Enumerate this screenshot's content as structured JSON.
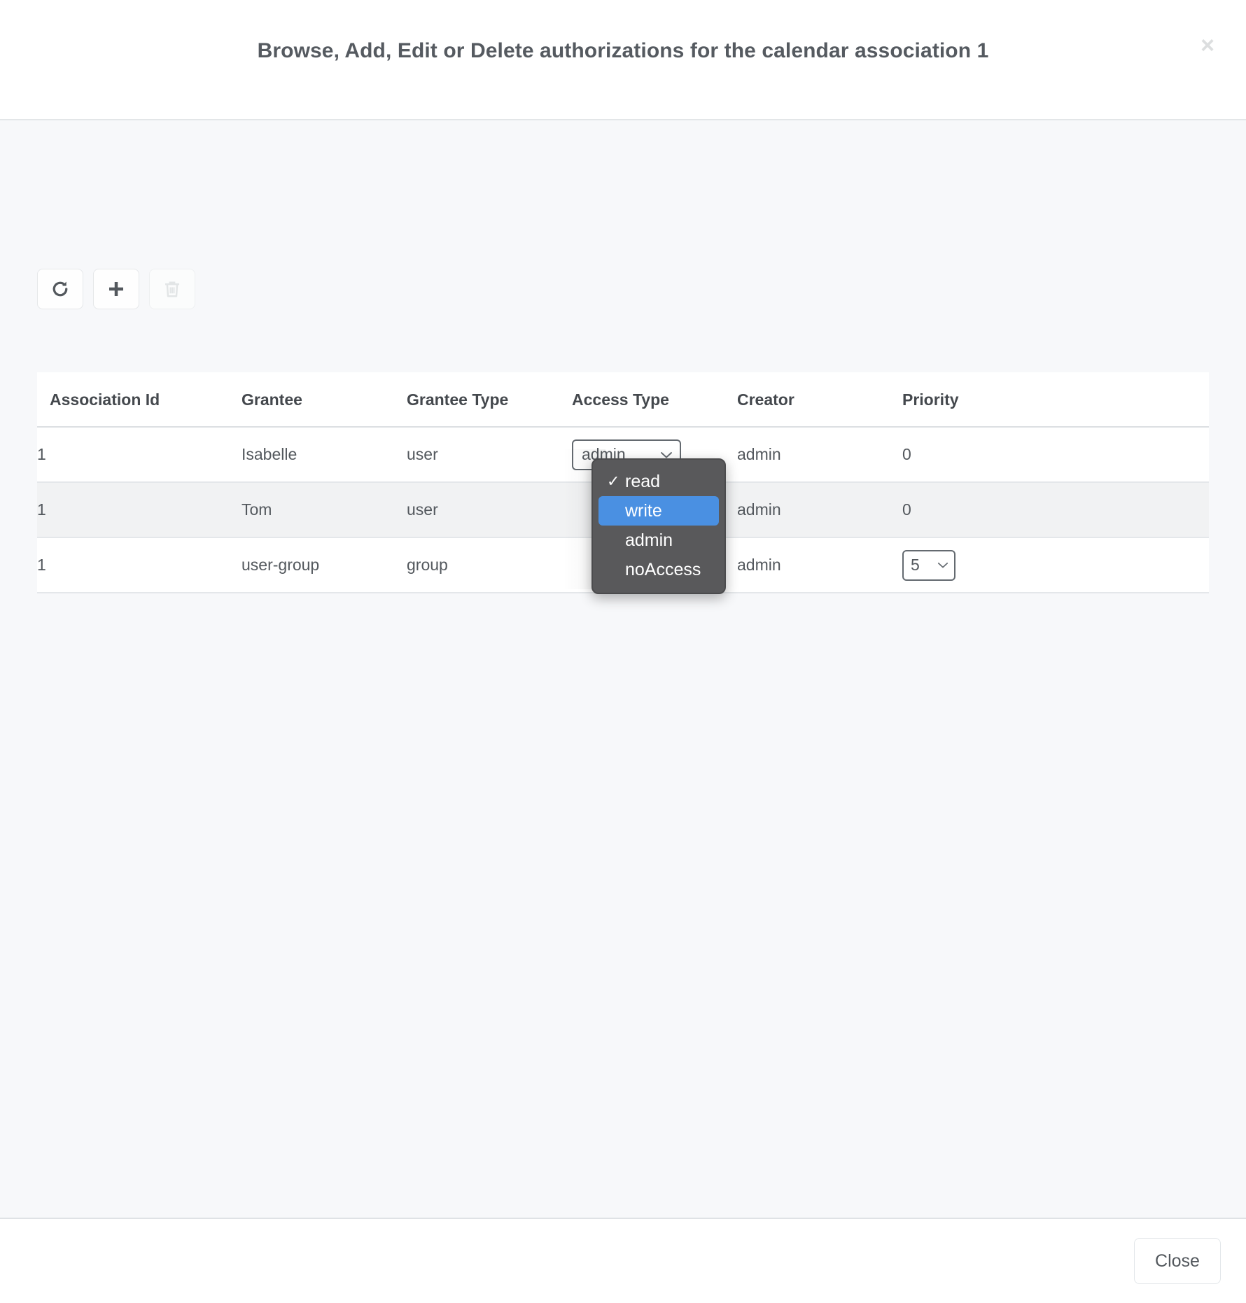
{
  "header": {
    "title": "Browse, Add, Edit or Delete authorizations for the calendar association 1",
    "close_icon": "close-x-icon",
    "close_glyph": "×"
  },
  "toolbar": {
    "buttons": [
      {
        "name": "refresh-button",
        "icon": "refresh-icon",
        "enabled": true
      },
      {
        "name": "add-button",
        "icon": "plus-icon",
        "enabled": true
      },
      {
        "name": "delete-button",
        "icon": "trash-icon",
        "enabled": false
      }
    ]
  },
  "table": {
    "columns": [
      "Association Id",
      "Grantee",
      "Grantee Type",
      "Access Type",
      "Creator",
      "Priority"
    ],
    "rows": [
      {
        "association_id": "1",
        "grantee": "Isabelle",
        "grantee_type": "user",
        "access_type": "admin",
        "access_type_is_select": true,
        "creator": "admin",
        "priority": "0",
        "priority_is_select": false,
        "striped": false
      },
      {
        "association_id": "1",
        "grantee": "Tom",
        "grantee_type": "user",
        "access_type": "",
        "access_type_is_select": false,
        "creator": "admin",
        "priority": "0",
        "priority_is_select": false,
        "striped": true
      },
      {
        "association_id": "1",
        "grantee": "user-group",
        "grantee_type": "group",
        "access_type": "",
        "access_type_is_select": false,
        "creator": "admin",
        "priority": "5",
        "priority_is_select": true,
        "striped": false
      }
    ]
  },
  "dropdown": {
    "open": true,
    "items": [
      {
        "label": "read",
        "checked": true,
        "highlighted": false
      },
      {
        "label": "write",
        "checked": false,
        "highlighted": true
      },
      {
        "label": "admin",
        "checked": false,
        "highlighted": false
      },
      {
        "label": "noAccess",
        "checked": false,
        "highlighted": false
      }
    ],
    "highlight_color": "#4a90e2",
    "background_color": "#59595b"
  },
  "footer": {
    "close_label": "Close"
  }
}
